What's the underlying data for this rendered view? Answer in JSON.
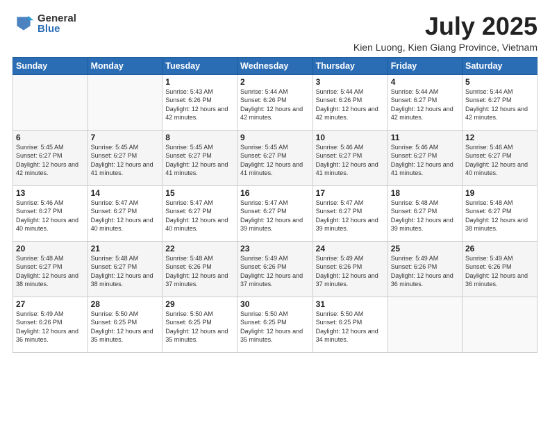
{
  "header": {
    "logo_general": "General",
    "logo_blue": "Blue",
    "month_title": "July 2025",
    "subtitle": "Kien Luong, Kien Giang Province, Vietnam"
  },
  "days_of_week": [
    "Sunday",
    "Monday",
    "Tuesday",
    "Wednesday",
    "Thursday",
    "Friday",
    "Saturday"
  ],
  "weeks": [
    [
      {
        "day": "",
        "info": ""
      },
      {
        "day": "",
        "info": ""
      },
      {
        "day": "1",
        "info": "Sunrise: 5:43 AM\nSunset: 6:26 PM\nDaylight: 12 hours and 42 minutes."
      },
      {
        "day": "2",
        "info": "Sunrise: 5:44 AM\nSunset: 6:26 PM\nDaylight: 12 hours and 42 minutes."
      },
      {
        "day": "3",
        "info": "Sunrise: 5:44 AM\nSunset: 6:26 PM\nDaylight: 12 hours and 42 minutes."
      },
      {
        "day": "4",
        "info": "Sunrise: 5:44 AM\nSunset: 6:27 PM\nDaylight: 12 hours and 42 minutes."
      },
      {
        "day": "5",
        "info": "Sunrise: 5:44 AM\nSunset: 6:27 PM\nDaylight: 12 hours and 42 minutes."
      }
    ],
    [
      {
        "day": "6",
        "info": "Sunrise: 5:45 AM\nSunset: 6:27 PM\nDaylight: 12 hours and 42 minutes."
      },
      {
        "day": "7",
        "info": "Sunrise: 5:45 AM\nSunset: 6:27 PM\nDaylight: 12 hours and 41 minutes."
      },
      {
        "day": "8",
        "info": "Sunrise: 5:45 AM\nSunset: 6:27 PM\nDaylight: 12 hours and 41 minutes."
      },
      {
        "day": "9",
        "info": "Sunrise: 5:45 AM\nSunset: 6:27 PM\nDaylight: 12 hours and 41 minutes."
      },
      {
        "day": "10",
        "info": "Sunrise: 5:46 AM\nSunset: 6:27 PM\nDaylight: 12 hours and 41 minutes."
      },
      {
        "day": "11",
        "info": "Sunrise: 5:46 AM\nSunset: 6:27 PM\nDaylight: 12 hours and 41 minutes."
      },
      {
        "day": "12",
        "info": "Sunrise: 5:46 AM\nSunset: 6:27 PM\nDaylight: 12 hours and 40 minutes."
      }
    ],
    [
      {
        "day": "13",
        "info": "Sunrise: 5:46 AM\nSunset: 6:27 PM\nDaylight: 12 hours and 40 minutes."
      },
      {
        "day": "14",
        "info": "Sunrise: 5:47 AM\nSunset: 6:27 PM\nDaylight: 12 hours and 40 minutes."
      },
      {
        "day": "15",
        "info": "Sunrise: 5:47 AM\nSunset: 6:27 PM\nDaylight: 12 hours and 40 minutes."
      },
      {
        "day": "16",
        "info": "Sunrise: 5:47 AM\nSunset: 6:27 PM\nDaylight: 12 hours and 39 minutes."
      },
      {
        "day": "17",
        "info": "Sunrise: 5:47 AM\nSunset: 6:27 PM\nDaylight: 12 hours and 39 minutes."
      },
      {
        "day": "18",
        "info": "Sunrise: 5:48 AM\nSunset: 6:27 PM\nDaylight: 12 hours and 39 minutes."
      },
      {
        "day": "19",
        "info": "Sunrise: 5:48 AM\nSunset: 6:27 PM\nDaylight: 12 hours and 38 minutes."
      }
    ],
    [
      {
        "day": "20",
        "info": "Sunrise: 5:48 AM\nSunset: 6:27 PM\nDaylight: 12 hours and 38 minutes."
      },
      {
        "day": "21",
        "info": "Sunrise: 5:48 AM\nSunset: 6:27 PM\nDaylight: 12 hours and 38 minutes."
      },
      {
        "day": "22",
        "info": "Sunrise: 5:48 AM\nSunset: 6:26 PM\nDaylight: 12 hours and 37 minutes."
      },
      {
        "day": "23",
        "info": "Sunrise: 5:49 AM\nSunset: 6:26 PM\nDaylight: 12 hours and 37 minutes."
      },
      {
        "day": "24",
        "info": "Sunrise: 5:49 AM\nSunset: 6:26 PM\nDaylight: 12 hours and 37 minutes."
      },
      {
        "day": "25",
        "info": "Sunrise: 5:49 AM\nSunset: 6:26 PM\nDaylight: 12 hours and 36 minutes."
      },
      {
        "day": "26",
        "info": "Sunrise: 5:49 AM\nSunset: 6:26 PM\nDaylight: 12 hours and 36 minutes."
      }
    ],
    [
      {
        "day": "27",
        "info": "Sunrise: 5:49 AM\nSunset: 6:26 PM\nDaylight: 12 hours and 36 minutes."
      },
      {
        "day": "28",
        "info": "Sunrise: 5:50 AM\nSunset: 6:25 PM\nDaylight: 12 hours and 35 minutes."
      },
      {
        "day": "29",
        "info": "Sunrise: 5:50 AM\nSunset: 6:25 PM\nDaylight: 12 hours and 35 minutes."
      },
      {
        "day": "30",
        "info": "Sunrise: 5:50 AM\nSunset: 6:25 PM\nDaylight: 12 hours and 35 minutes."
      },
      {
        "day": "31",
        "info": "Sunrise: 5:50 AM\nSunset: 6:25 PM\nDaylight: 12 hours and 34 minutes."
      },
      {
        "day": "",
        "info": ""
      },
      {
        "day": "",
        "info": ""
      }
    ]
  ]
}
